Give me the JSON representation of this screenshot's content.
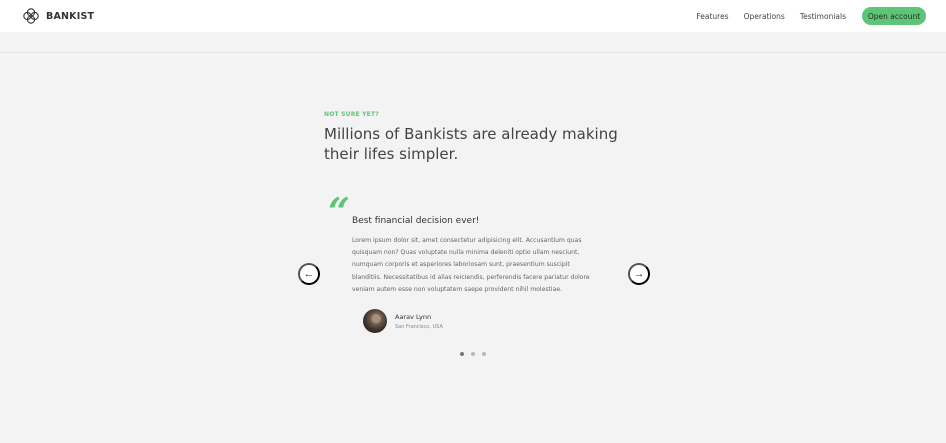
{
  "nav": {
    "logo_text": "BANKIST",
    "links": [
      "Features",
      "Operations",
      "Testimonials"
    ],
    "cta_label": "Open account"
  },
  "section": {
    "kicker": "NOT SURE YET?",
    "title_line1": "Millions of Bankists are already making",
    "title_line2": "their lifes simpler."
  },
  "testimonial": {
    "quote_mark": "“",
    "header": "Best financial decision ever!",
    "text": "Lorem ipsum dolor sit, amet consectetur adipisicing elit. Accusantium quas quisquam non? Quas voluptate nulla minima deleniti optio ullam nesciunt, numquam corporis et asperiores laboriosam sunt, praesentium suscipit blanditiis. Necessitatibus id alias reiciendis, perferendis facere pariatur dolore veniam autem esse non voluptatem saepe provident nihil molestiae.",
    "author_name": "Aarav Lynn",
    "author_location": "San Francisco, USA"
  },
  "slider": {
    "left_arrow": "←",
    "right_arrow": "→",
    "dot_count": 3,
    "active_dot": 1
  },
  "colors": {
    "accent": "#5ec576",
    "background": "#f3f3f3",
    "nav_background": "#ffffff"
  }
}
